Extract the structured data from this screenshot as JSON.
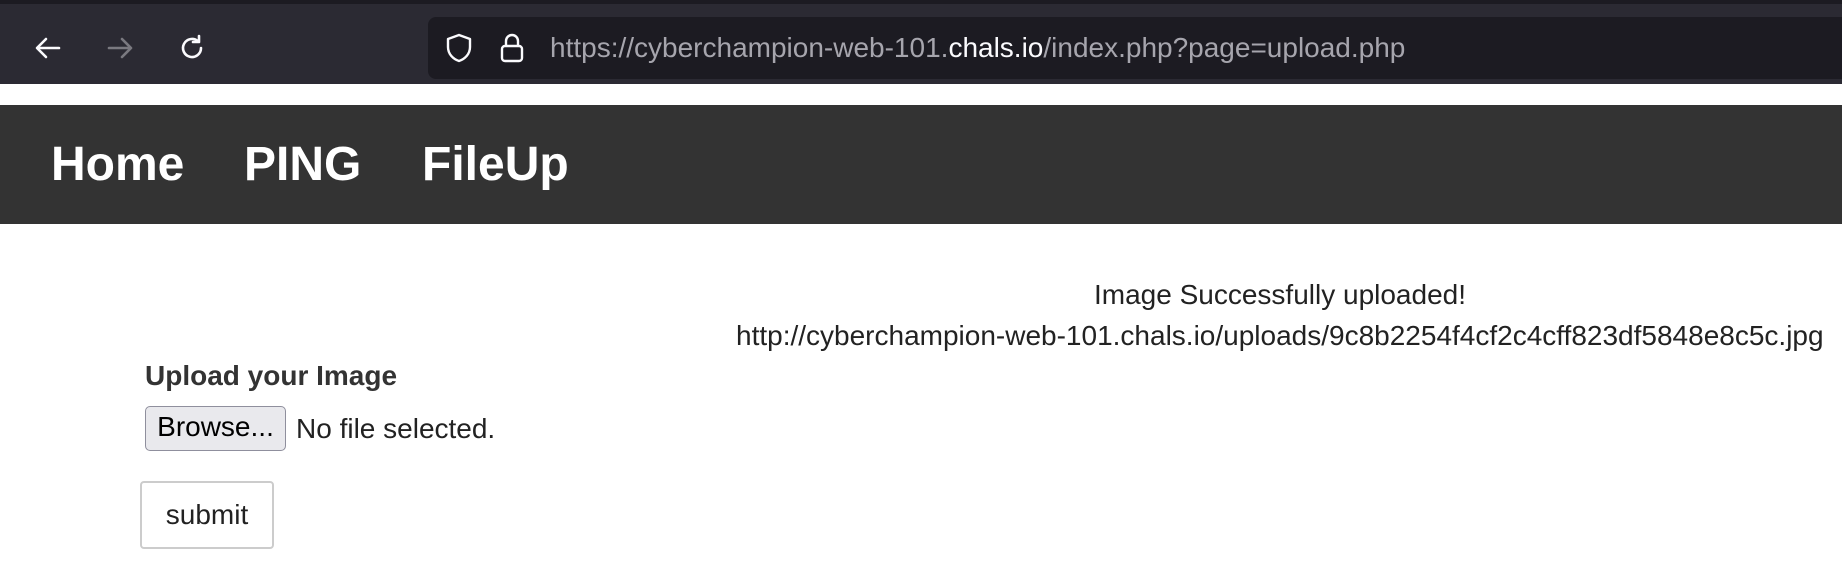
{
  "browser": {
    "url_prefix": "https://cyberchampion-web-101.",
    "url_domain": "chals.io",
    "url_suffix": "/index.php?page=upload.php"
  },
  "navbar": {
    "items": [
      {
        "label": "Home"
      },
      {
        "label": "PING"
      },
      {
        "label": "FileUp"
      }
    ]
  },
  "upload": {
    "success_message": "Image Successfully uploaded!",
    "uploaded_url": "http://cyberchampion-web-101.chals.io/uploads/9c8b2254f4cf2c4cff823df5848e8c5c.jpg",
    "form_label": "Upload your Image",
    "browse_label": "Browse...",
    "file_status": "No file selected.",
    "submit_label": "submit"
  },
  "icons": {
    "back": "arrow-left-icon",
    "forward": "arrow-right-icon",
    "reload": "reload-icon",
    "shield": "shield-icon",
    "lock": "lock-icon"
  },
  "colors": {
    "browser_chrome": "#2b2a33",
    "url_field": "#1c1b22",
    "navbar_bg": "#333333",
    "navbar_text": "#ffffff"
  }
}
